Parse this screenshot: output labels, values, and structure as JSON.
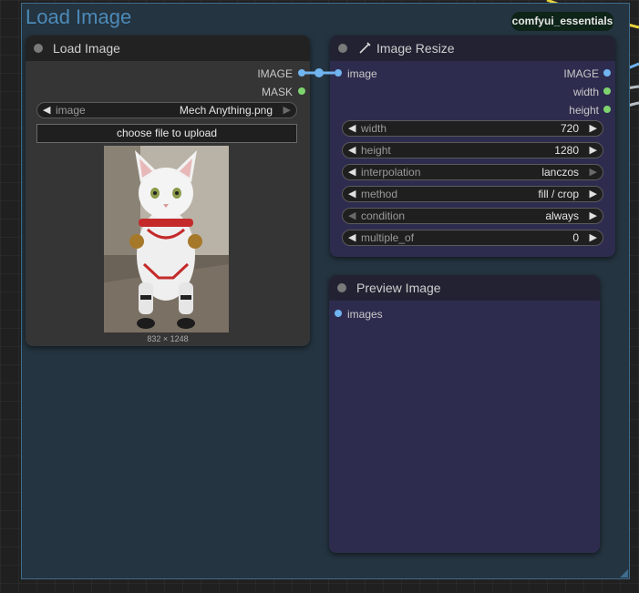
{
  "group": {
    "title": "Load Image"
  },
  "badge": {
    "label": "comfyui_essentials"
  },
  "load_image_node": {
    "title": "Load Image",
    "outputs": [
      "IMAGE",
      "MASK"
    ],
    "image_widget": {
      "label": "image",
      "value": "Mech Anything.png"
    },
    "upload_button": "choose file to upload",
    "image_caption": "832 × 1248"
  },
  "image_resize_node": {
    "title": "Image Resize",
    "input": "image",
    "outputs": [
      "IMAGE",
      "width",
      "height"
    ],
    "widgets": [
      {
        "label": "width",
        "value": "720"
      },
      {
        "label": "height",
        "value": "1280"
      },
      {
        "label": "interpolation",
        "value": "lanczos"
      },
      {
        "label": "method",
        "value": "fill / crop"
      },
      {
        "label": "condition",
        "value": "always"
      },
      {
        "label": "multiple_of",
        "value": "0"
      }
    ]
  },
  "preview_image_node": {
    "title": "Preview Image",
    "input": "images"
  },
  "colors": {
    "link_image": "#70b4f0",
    "link_int": "#7ed36e",
    "link_yellow": "#e8d23a",
    "group_title": "#4c8ab8"
  }
}
